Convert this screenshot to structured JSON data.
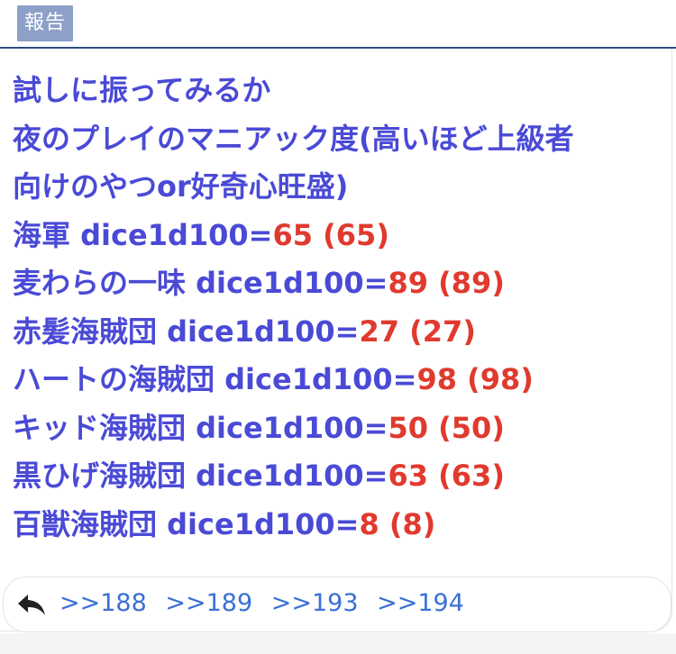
{
  "header": {
    "report_label": "報告"
  },
  "post": {
    "text_lines": [
      "試しに振ってみるか",
      "夜のプレイのマニアック度(高いほど上級者",
      "向けのやつor好奇心旺盛)"
    ],
    "dice_rolls": [
      {
        "label": "海軍 dice1d100=",
        "result": "65",
        "detail": " (65)"
      },
      {
        "label": "麦わらの一味 dice1d100=",
        "result": "89",
        "detail": " (89)"
      },
      {
        "label": "赤髪海賊団 dice1d100=",
        "result": "27",
        "detail": " (27)"
      },
      {
        "label": "ハートの海賊団 dice1d100=",
        "result": "98",
        "detail": " (98)"
      },
      {
        "label": "キッド海賊団 dice1d100=",
        "result": "50",
        "detail": " (50)"
      },
      {
        "label": "黒ひげ海賊団 dice1d100=",
        "result": "63",
        "detail": " (63)"
      },
      {
        "label": "百獣海賊団 dice1d100=",
        "result": "8",
        "detail": " (8)"
      }
    ]
  },
  "replies": {
    "icon": "reply-icon",
    "anchors": [
      ">>188",
      ">>189",
      ">>193",
      ">>194"
    ]
  },
  "colors": {
    "body_text": "#4a4ad6",
    "dice_result": "#e03a2e",
    "anchor_link": "#3a6fd6",
    "report_bg": "#8ca0c8",
    "header_rule": "#2c4a80"
  }
}
